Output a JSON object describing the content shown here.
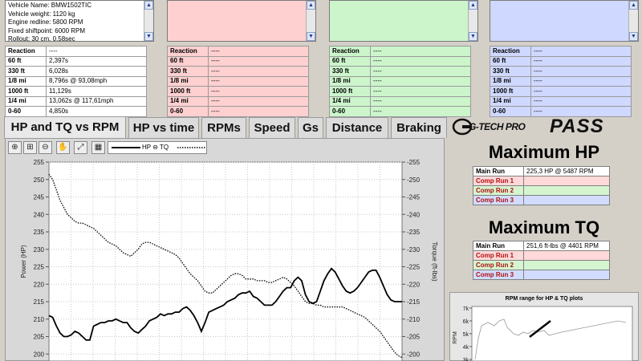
{
  "info": {
    "lines": [
      "Vehicle Name: BMW1502TIC",
      "Vehicle weight: 1120 kg",
      "Engine redline: 5800 RPM",
      "Fixed shiftpoint: 6000 RPM",
      "Rollout: 30 cm, 0.58sec"
    ]
  },
  "stats": {
    "labels": [
      "Reaction",
      "60 ft",
      "330 ft",
      "1/8 mi",
      "1000 ft",
      "1/4 mi",
      "0-60"
    ],
    "main_values": [
      "----",
      "2,397s",
      "6,028s",
      "8,796s @ 93,08mph",
      "11,129s",
      "13,062s @ 117,61mph",
      "4,850s"
    ],
    "comp_values": [
      "----",
      "----",
      "----",
      "----",
      "----",
      "----",
      "----"
    ]
  },
  "tabs": [
    "HP and TQ vs RPM",
    "HP vs time",
    "RPMs",
    "Speed",
    "Gs",
    "Distance",
    "Braking"
  ],
  "logo": {
    "brand": "G-TECH PRO",
    "product": "PASS"
  },
  "toolbar": {
    "legend": "HP ⊖ TQ"
  },
  "chart_data": {
    "type": "line",
    "xlabel": "",
    "ylabel": "Power (HP)",
    "y2label": "Torque (ft-lbs)",
    "ylim": [
      198,
      255
    ],
    "y_ticks": [
      "255",
      "250",
      "245",
      "240",
      "235",
      "230",
      "225",
      "220",
      "215",
      "210",
      "205",
      "200"
    ],
    "y2_ticks": [
      "255",
      "250",
      "245",
      "240",
      "235",
      "230",
      "225",
      "220",
      "215",
      "210",
      "205",
      "200"
    ],
    "grid": true,
    "series": [
      {
        "name": "HP",
        "style": "solid",
        "values": [
          211,
          210.5,
          208,
          206,
          205,
          205,
          205.5,
          206.5,
          206,
          205,
          204,
          204,
          208,
          208.5,
          209,
          209,
          209.5,
          209.5,
          210,
          209.5,
          209,
          209,
          207.5,
          206.5,
          206,
          207,
          208,
          209.5,
          210,
          210.5,
          211.5,
          211,
          211.5,
          211.5,
          212,
          212,
          213,
          213.5,
          212.5,
          211,
          209,
          206.5,
          209,
          212,
          212.5,
          213,
          213.5,
          214,
          215,
          215.5,
          216,
          217,
          217.5,
          217.5,
          218,
          216.5,
          216,
          215,
          214,
          214,
          214,
          215,
          216.5,
          218,
          219,
          219,
          221,
          222,
          221,
          217,
          215,
          214.5,
          215,
          218,
          221,
          223,
          224.5,
          223.5,
          221.5,
          219.5,
          218,
          217.5,
          218,
          219,
          220.5,
          222,
          223.5,
          224,
          224,
          222,
          219.5,
          217,
          215.5,
          215,
          215,
          215
        ]
      },
      {
        "name": "TQ",
        "style": "dotted",
        "values": [
          251.5,
          250,
          247,
          244,
          242,
          240,
          239,
          238,
          237.5,
          237.5,
          237,
          236.5,
          236,
          235,
          234,
          233,
          232,
          231.5,
          231,
          230,
          229,
          228.5,
          228,
          229,
          230,
          231.5,
          232,
          232,
          231.5,
          231,
          230.5,
          230,
          229.5,
          229,
          228.5,
          227.5,
          226,
          224.5,
          223,
          222,
          221,
          219.5,
          218,
          217.5,
          217.5,
          218.5,
          219.5,
          220.5,
          221.5,
          222.5,
          223,
          223,
          222.5,
          221.5,
          221.5,
          221.5,
          221,
          221,
          221,
          220.5,
          220.5,
          221,
          221.5,
          222,
          221.5,
          220.5,
          219.5,
          218,
          216.5,
          215,
          214.5,
          214.5,
          214,
          214,
          213.5,
          213.5,
          213.5,
          213.5,
          213.5,
          213.5,
          213,
          212.5,
          212,
          211.5,
          211,
          210.5,
          209.5,
          208.5,
          207.5,
          206.5,
          205,
          203.5,
          202,
          200.5,
          199.5,
          199
        ]
      }
    ]
  },
  "max_hp": {
    "title": "Maximum HP",
    "rows": [
      {
        "label": "Main Run",
        "value": "225,3 HP @ 5487 RPM",
        "color": "#ffffff"
      },
      {
        "label": "Comp Run 1",
        "value": "",
        "color": "#ffd9d9"
      },
      {
        "label": "Comp Run 2",
        "value": "",
        "color": "#d5f5d0"
      },
      {
        "label": "Comp Run 3",
        "value": "",
        "color": "#d2dcff"
      }
    ]
  },
  "max_tq": {
    "title": "Maximum TQ",
    "rows": [
      {
        "label": "Main Run",
        "value": "251,6 ft-lbs @ 4401 RPM",
        "color": "#ffffff"
      },
      {
        "label": "Comp Run 1",
        "value": "",
        "color": "#ffd9d9"
      },
      {
        "label": "Comp Run 2",
        "value": "",
        "color": "#d5f5d0"
      },
      {
        "label": "Comp Run 3",
        "value": "",
        "color": "#d2dcff"
      }
    ]
  },
  "rpm_chart": {
    "title": "RPM range for HP & TQ plots",
    "ylabel": "RPM",
    "ticks": [
      "7k",
      "6k",
      "5k",
      "4k",
      "3k"
    ]
  },
  "colors": {
    "run1": "#ffd0d0",
    "run2": "#ccf5cc",
    "run3": "#cfd8ff"
  }
}
